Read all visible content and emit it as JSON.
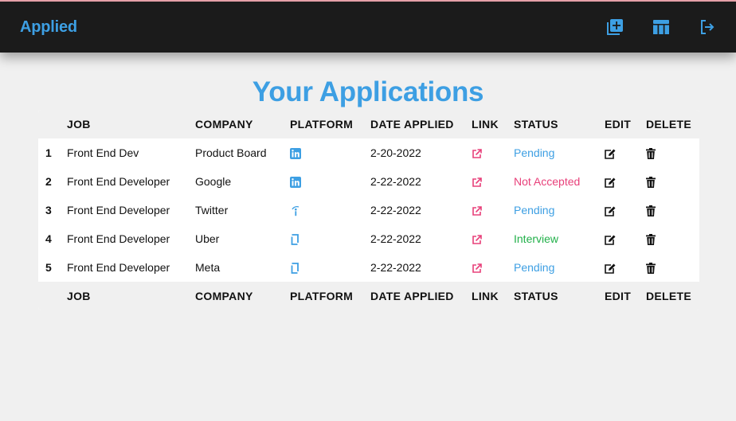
{
  "app": {
    "brand": "Applied",
    "nav_icons": [
      "add-application-icon",
      "table-view-icon",
      "logout-icon"
    ],
    "colors": {
      "accent": "#3d9fe3",
      "link": "#e8407a",
      "pending": "#3d9fe3",
      "not_accepted": "#e8407a",
      "interview": "#22b04a",
      "topbar": "#1b1b1b"
    }
  },
  "main": {
    "title": "Your Applications",
    "columns": [
      "JOB",
      "COMPANY",
      "PLATFORM",
      "DATE APPLIED",
      "LINK",
      "STATUS",
      "EDIT",
      "DELETE"
    ],
    "rows": [
      {
        "num": "1",
        "job": "Front End Dev",
        "company": "Product Board",
        "platform_icon": "linkedin-icon",
        "date": "2-20-2022",
        "status": "Pending"
      },
      {
        "num": "2",
        "job": "Front End Developer",
        "company": "Google",
        "platform_icon": "linkedin-icon",
        "date": "2-22-2022",
        "status": "Not Accepted"
      },
      {
        "num": "3",
        "job": "Front End Developer",
        "company": "Twitter",
        "platform_icon": "indeed-icon",
        "date": "2-22-2022",
        "status": "Pending"
      },
      {
        "num": "4",
        "job": "Front End Developer",
        "company": "Uber",
        "platform_icon": "glassdoor-icon",
        "date": "2-22-2022",
        "status": "Interview"
      },
      {
        "num": "5",
        "job": "Front End Developer",
        "company": "Meta",
        "platform_icon": "glassdoor-icon",
        "date": "2-22-2022",
        "status": "Pending"
      }
    ]
  }
}
